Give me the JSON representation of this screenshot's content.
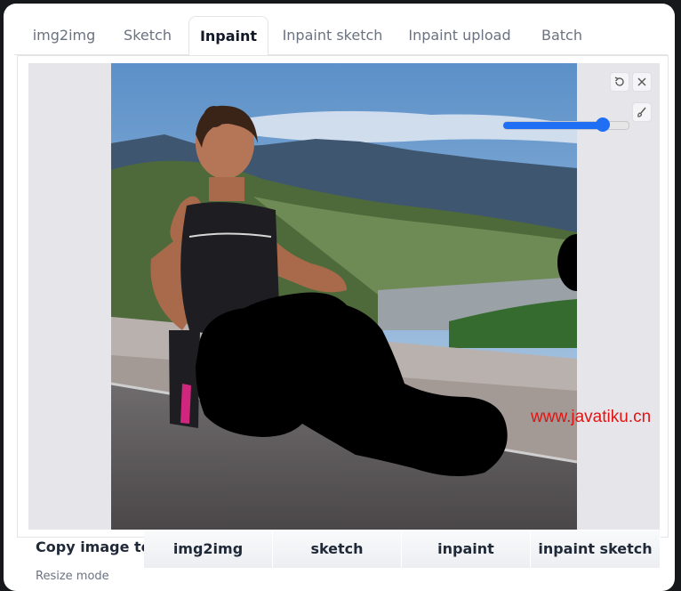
{
  "tabs": [
    {
      "label": "img2img"
    },
    {
      "label": "Sketch"
    },
    {
      "label": "Inpaint",
      "active": true
    },
    {
      "label": "Inpaint sketch"
    },
    {
      "label": "Inpaint upload"
    },
    {
      "label": "Batch"
    }
  ],
  "editor": {
    "controls": [
      {
        "icon": "undo-icon"
      },
      {
        "icon": "close-icon"
      },
      {
        "icon": "brush-icon"
      }
    ],
    "brush_size": {
      "fraction": 0.8
    }
  },
  "watermark": "www.javatiku.cn",
  "copy": {
    "label": "Copy image to:",
    "buttons": [
      "img2img",
      "sketch",
      "inpaint",
      "inpaint sketch"
    ]
  },
  "resize_mode_label": "Resize mode",
  "colors": {
    "accent": "#1f6ff5",
    "mask": "#000000",
    "watermark": "#e01414"
  }
}
